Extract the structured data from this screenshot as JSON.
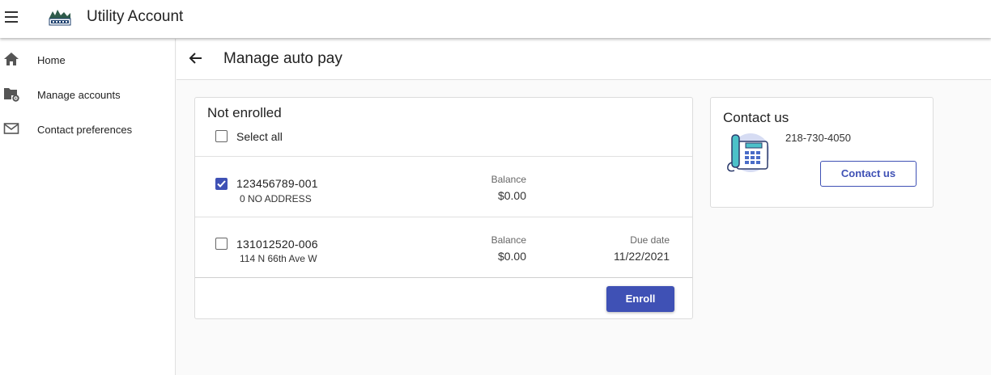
{
  "app": {
    "title": "Utility Account",
    "menu_icon": "hamburger-menu-icon",
    "logo_icon": "city-logo-icon"
  },
  "sidebar": {
    "items": [
      {
        "label": "Home",
        "icon": "home-icon"
      },
      {
        "label": "Manage accounts",
        "icon": "folder-settings-icon"
      },
      {
        "label": "Contact preferences",
        "icon": "mail-icon"
      }
    ]
  },
  "page": {
    "title": "Manage auto pay",
    "back_icon": "arrow-left-icon"
  },
  "not_enrolled": {
    "title": "Not enrolled",
    "select_all_label": "Select all",
    "select_all_checked": false,
    "accounts": [
      {
        "number": "123456789-001",
        "address": "0 NO ADDRESS",
        "balance_label": "Balance",
        "balance": "$0.00",
        "due_label": "",
        "due_date": "",
        "checked": true
      },
      {
        "number": "131012520-006",
        "address": "114 N 66th Ave W",
        "balance_label": "Balance",
        "balance": "$0.00",
        "due_label": "Due date",
        "due_date": "11/22/2021",
        "checked": false
      }
    ],
    "enroll_label": "Enroll"
  },
  "contact": {
    "title": "Contact us",
    "phone": "218-730-4050",
    "button_label": "Contact us",
    "illustration_icon": "telephone-icon"
  },
  "colors": {
    "primary": "#3f51b5",
    "divider": "#e0e0e0",
    "background": "#fafafa"
  }
}
